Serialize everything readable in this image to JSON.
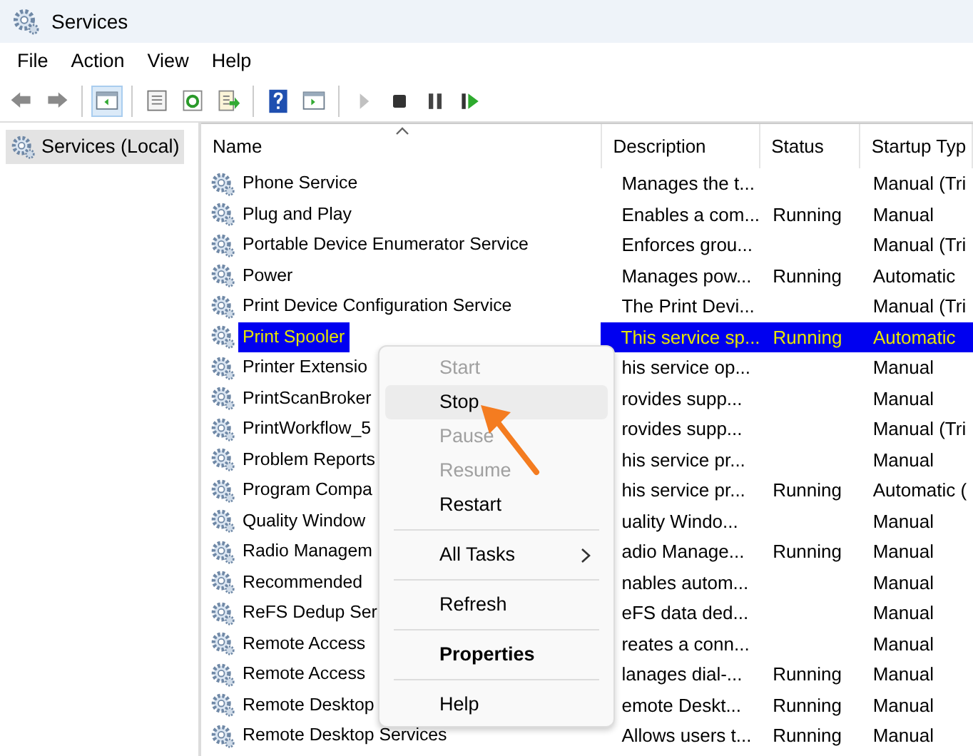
{
  "window": {
    "title": "Services"
  },
  "menu_bar": [
    "File",
    "Action",
    "View",
    "Help"
  ],
  "toolbar": [
    {
      "kind": "back",
      "pressed": false,
      "disabled": false
    },
    {
      "kind": "forward",
      "pressed": false,
      "disabled": false
    },
    {
      "kind": "separator"
    },
    {
      "kind": "tree-pane",
      "pressed": true,
      "disabled": false
    },
    {
      "kind": "separator"
    },
    {
      "kind": "properties",
      "pressed": false,
      "disabled": false
    },
    {
      "kind": "refresh",
      "pressed": false,
      "disabled": false
    },
    {
      "kind": "export",
      "pressed": false,
      "disabled": false
    },
    {
      "kind": "separator"
    },
    {
      "kind": "help",
      "pressed": false,
      "disabled": false
    },
    {
      "kind": "action-pane",
      "pressed": false,
      "disabled": false
    },
    {
      "kind": "separator"
    },
    {
      "kind": "start",
      "pressed": false,
      "disabled": true
    },
    {
      "kind": "stop",
      "pressed": false,
      "disabled": false
    },
    {
      "kind": "pause",
      "pressed": false,
      "disabled": false
    },
    {
      "kind": "resume",
      "pressed": false,
      "disabled": false
    }
  ],
  "tree": {
    "items": [
      {
        "label": "Services (Local)",
        "selected": true
      }
    ]
  },
  "table": {
    "columns": [
      {
        "label": "Name",
        "sorted": true
      },
      {
        "label": "Description",
        "sorted": false
      },
      {
        "label": "Status",
        "sorted": false
      },
      {
        "label": "Startup Typ",
        "sorted": false
      }
    ],
    "rows": [
      {
        "name": "Phone Service",
        "description": "Manages the t...",
        "status": "",
        "startup_type": "Manual (Tri",
        "selected": false
      },
      {
        "name": "Plug and Play",
        "description": "Enables a com...",
        "status": "Running",
        "startup_type": "Manual",
        "selected": false
      },
      {
        "name": "Portable Device Enumerator Service",
        "description": "Enforces grou...",
        "status": "",
        "startup_type": "Manual (Tri",
        "selected": false
      },
      {
        "name": "Power",
        "description": "Manages pow...",
        "status": "Running",
        "startup_type": "Automatic",
        "selected": false
      },
      {
        "name": "Print Device Configuration Service",
        "description": "The Print Devi...",
        "status": "",
        "startup_type": "Manual (Tri",
        "selected": false
      },
      {
        "name": "Print Spooler",
        "description": "This service sp...",
        "status": "Running",
        "startup_type": "Automatic",
        "selected": true
      },
      {
        "name": "Printer Extensio",
        "description": "his service op...",
        "status": "",
        "startup_type": "Manual",
        "selected": false
      },
      {
        "name": "PrintScanBroker",
        "description": "rovides supp...",
        "status": "",
        "startup_type": "Manual",
        "selected": false
      },
      {
        "name": "PrintWorkflow_5",
        "description": "rovides supp...",
        "status": "",
        "startup_type": "Manual (Tri",
        "selected": false
      },
      {
        "name": "Problem Reports",
        "description": "his service pr...",
        "status": "",
        "startup_type": "Manual",
        "selected": false
      },
      {
        "name": "Program Compa",
        "description": "his service pr...",
        "status": "Running",
        "startup_type": "Automatic (",
        "selected": false
      },
      {
        "name": "Quality Window",
        "description": "uality Windo...",
        "status": "",
        "startup_type": "Manual",
        "selected": false
      },
      {
        "name": "Radio Managem",
        "description": "adio Manage...",
        "status": "Running",
        "startup_type": "Manual",
        "selected": false
      },
      {
        "name": "Recommended",
        "description": "nables autom...",
        "status": "",
        "startup_type": "Manual",
        "selected": false
      },
      {
        "name": "ReFS Dedup Ser",
        "description": "eFS data ded...",
        "status": "",
        "startup_type": "Manual",
        "selected": false
      },
      {
        "name": "Remote Access",
        "description": "reates a conn...",
        "status": "",
        "startup_type": "Manual",
        "selected": false
      },
      {
        "name": "Remote Access",
        "description": "lanages dial-...",
        "status": "Running",
        "startup_type": "Manual",
        "selected": false
      },
      {
        "name": "Remote Desktop",
        "description": "emote Deskt...",
        "status": "Running",
        "startup_type": "Manual",
        "selected": false
      },
      {
        "name": "Remote Desktop Services",
        "description": "Allows users t...",
        "status": "Running",
        "startup_type": "Manual",
        "selected": false
      }
    ]
  },
  "context_menu": {
    "items": [
      {
        "kind": "item",
        "label": "Start",
        "disabled": true,
        "highlighted": false,
        "default": false,
        "submenu": false
      },
      {
        "kind": "item",
        "label": "Stop",
        "disabled": false,
        "highlighted": true,
        "default": false,
        "submenu": false
      },
      {
        "kind": "item",
        "label": "Pause",
        "disabled": true,
        "highlighted": false,
        "default": false,
        "submenu": false
      },
      {
        "kind": "item",
        "label": "Resume",
        "disabled": true,
        "highlighted": false,
        "default": false,
        "submenu": false
      },
      {
        "kind": "item",
        "label": "Restart",
        "disabled": false,
        "highlighted": false,
        "default": false,
        "submenu": false
      },
      {
        "kind": "separator"
      },
      {
        "kind": "item",
        "label": "All Tasks",
        "disabled": false,
        "highlighted": false,
        "default": false,
        "submenu": true
      },
      {
        "kind": "separator"
      },
      {
        "kind": "item",
        "label": "Refresh",
        "disabled": false,
        "highlighted": false,
        "default": false,
        "submenu": false
      },
      {
        "kind": "separator"
      },
      {
        "kind": "item",
        "label": "Properties",
        "disabled": false,
        "highlighted": false,
        "default": true,
        "submenu": false
      },
      {
        "kind": "separator"
      },
      {
        "kind": "item",
        "label": "Help",
        "disabled": false,
        "highlighted": false,
        "default": false,
        "submenu": false
      }
    ]
  }
}
